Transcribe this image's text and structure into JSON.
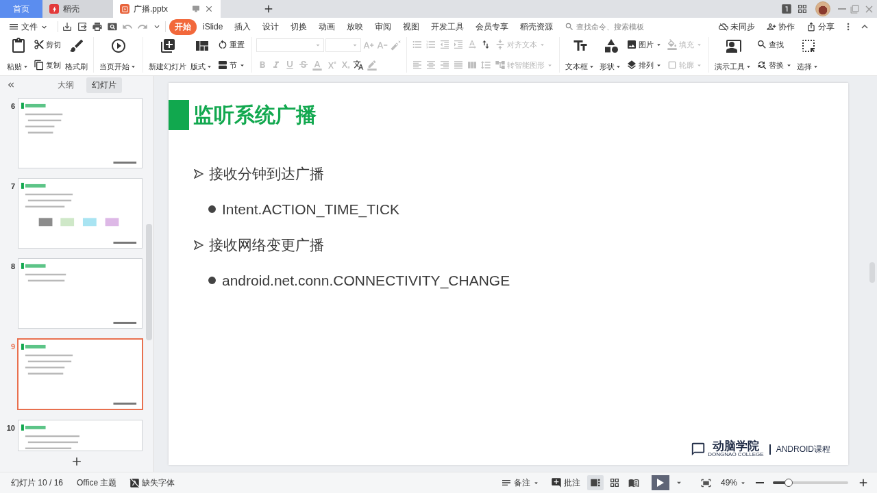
{
  "tabs": [
    {
      "label": "首页",
      "kind": "home",
      "selected": false
    },
    {
      "label": "稻壳",
      "kind": "docer",
      "selected": false
    },
    {
      "label": "广播.pptx",
      "kind": "doc",
      "selected": true
    }
  ],
  "menu": {
    "file": "文件",
    "tabs": [
      {
        "label": "开始",
        "selected": true
      },
      {
        "label": "iSlide",
        "selected": false
      },
      {
        "label": "插入",
        "selected": false
      },
      {
        "label": "设计",
        "selected": false
      },
      {
        "label": "切换",
        "selected": false
      },
      {
        "label": "动画",
        "selected": false
      },
      {
        "label": "放映",
        "selected": false
      },
      {
        "label": "审阅",
        "selected": false
      },
      {
        "label": "视图",
        "selected": false
      },
      {
        "label": "开发工具",
        "selected": false
      },
      {
        "label": "会员专享",
        "selected": false
      },
      {
        "label": "稻壳资源",
        "selected": false
      }
    ],
    "search": {
      "placeholder": "查找命令、搜索模板"
    },
    "actions": [
      "未同步",
      "协作",
      "分享"
    ]
  },
  "ribbon": {
    "groups": [
      [
        {
          "kind": "big",
          "label": "粘贴",
          "menu": true,
          "disabled": false
        },
        {
          "kind": "stack",
          "items": [
            {
              "label": "剪切",
              "menu": false,
              "disabled": false
            },
            {
              "label": "复制",
              "menu": false,
              "disabled": false
            }
          ]
        },
        {
          "kind": "big",
          "label": "格式刷",
          "menu": false,
          "disabled": false
        }
      ],
      [
        {
          "kind": "big",
          "label": "当页开始",
          "menu": true,
          "disabled": false
        }
      ],
      [
        {
          "kind": "big",
          "label": "新建幻灯片",
          "menu": false,
          "disabled": false
        },
        {
          "kind": "big",
          "label": "版式",
          "menu": true,
          "disabled": false
        },
        {
          "kind": "stack",
          "items": [
            {
              "label": "重置",
              "menu": false,
              "disabled": false
            },
            {
              "label": "节",
              "menu": true,
              "disabled": false
            }
          ]
        }
      ],
      [
        {
          "kind": "tools",
          "rows": [
            [
              {
                "kind": "combo",
                "disabled": true
              },
              {
                "kind": "combo",
                "disabled": true
              },
              {
                "kind": "icon",
                "disabled": true
              },
              {
                "kind": "icon",
                "disabled": true
              },
              {
                "kind": "icon",
                "disabled": true
              }
            ],
            [
              {
                "kind": "icon",
                "disabled": true
              },
              {
                "kind": "icon",
                "disabled": true
              },
              {
                "kind": "icon",
                "disabled": true
              },
              {
                "kind": "icon",
                "disabled": true
              },
              {
                "kind": "icon",
                "disabled": true
              },
              {
                "kind": "icon",
                "disabled": true
              },
              {
                "kind": "icon",
                "disabled": true
              },
              {
                "kind": "icon",
                "disabled": false
              },
              {
                "kind": "icon",
                "disabled": true
              }
            ]
          ]
        }
      ],
      [
        {
          "kind": "tools",
          "rows": [
            [
              {
                "kind": "icon",
                "disabled": true
              },
              {
                "kind": "icon",
                "disabled": true
              },
              {
                "kind": "icon",
                "disabled": true
              },
              {
                "kind": "icon",
                "disabled": true
              },
              {
                "kind": "icon",
                "disabled": true
              },
              {
                "kind": "icon",
                "disabled": false
              }
            ],
            [
              {
                "kind": "icon",
                "disabled": true
              },
              {
                "kind": "icon",
                "disabled": true
              },
              {
                "kind": "icon",
                "disabled": true
              },
              {
                "kind": "icon",
                "disabled": true
              },
              {
                "kind": "icon",
                "disabled": true
              },
              {
                "kind": "icon",
                "disabled": true
              }
            ]
          ]
        },
        {
          "kind": "stack",
          "items": [
            {
              "label": "对齐文本",
              "menu": true,
              "disabled": true
            },
            {
              "label": "转智能图形",
              "menu": true,
              "disabled": true
            }
          ]
        }
      ],
      [
        {
          "kind": "big",
          "label": "文本框",
          "menu": true,
          "disabled": false
        },
        {
          "kind": "big",
          "label": "形状",
          "menu": true,
          "disabled": false
        },
        {
          "kind": "stack",
          "items": [
            {
              "label": "图片",
              "menu": true,
              "disabled": false
            },
            {
              "label": "排列",
              "menu": true,
              "disabled": false
            }
          ]
        },
        {
          "kind": "stack",
          "items": [
            {
              "label": "填充",
              "menu": true,
              "disabled": true
            },
            {
              "label": "轮廓",
              "menu": true,
              "disabled": true
            }
          ]
        }
      ],
      [
        {
          "kind": "big",
          "label": "演示工具",
          "menu": true,
          "disabled": false
        },
        {
          "kind": "stack",
          "items": [
            {
              "label": "查找",
              "menu": false,
              "disabled": false
            },
            {
              "label": "替换",
              "menu": true,
              "disabled": false
            }
          ]
        },
        {
          "kind": "big",
          "label": "选择",
          "menu": true,
          "disabled": false
        }
      ]
    ]
  },
  "panel": {
    "tabs": [
      {
        "label": "大纲",
        "selected": false
      },
      {
        "label": "幻灯片",
        "selected": true
      }
    ],
    "thumbnails": [
      {
        "number": "6",
        "selected": false
      },
      {
        "number": "7",
        "selected": false
      },
      {
        "number": "8",
        "selected": false
      },
      {
        "number": "9",
        "selected": true
      },
      {
        "number": "10",
        "selected": false
      }
    ]
  },
  "slide": {
    "title": "监听系统广播",
    "bullets": [
      {
        "kind": "arrow",
        "text": "接收分钟到达广播"
      },
      {
        "kind": "dot",
        "text": "Intent.ACTION_TIME_TICK"
      },
      {
        "kind": "arrow",
        "text": "接收网络变更广播"
      },
      {
        "kind": "dot",
        "text": "android.net.conn.CONNECTIVITY_CHANGE"
      }
    ],
    "logo": {
      "name": "动脑学院",
      "subtitle": "DONGNAO COLLEGE"
    },
    "course": "ANDROID课程"
  },
  "status": {
    "slide": "幻灯片 10 / 16",
    "theme": "Office 主题",
    "missing_fonts": "缺失字体",
    "notes": "备注",
    "comments": "批注",
    "views": [
      {
        "selected": true
      },
      {
        "selected": false
      },
      {
        "selected": false
      }
    ],
    "zoom": "49%",
    "zoom_slider": {
      "level": 0.21
    }
  }
}
